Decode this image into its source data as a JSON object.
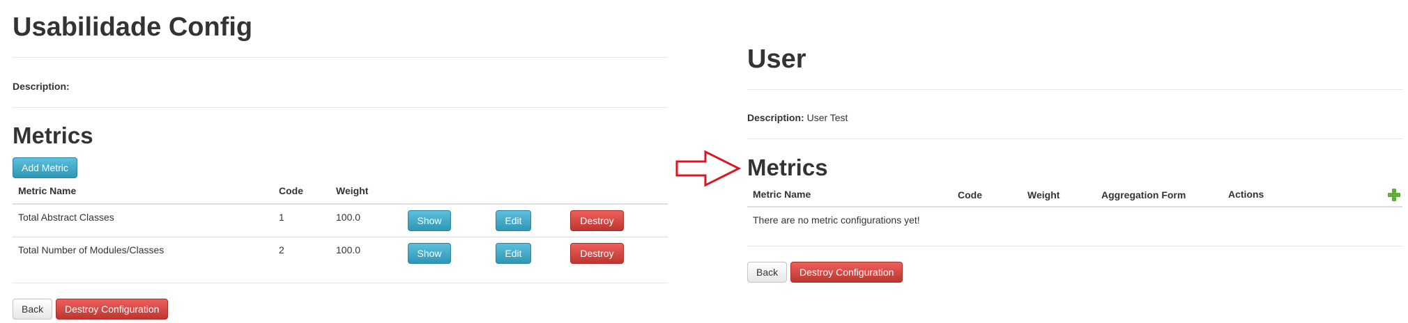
{
  "left": {
    "title": "Usabilidade Config",
    "description_label": "Description:",
    "description_value": "",
    "metrics_heading": "Metrics",
    "add_metric_label": "Add Metric",
    "table": {
      "headers": [
        "Metric Name",
        "Code",
        "Weight"
      ],
      "rows": [
        {
          "name": "Total Abstract Classes",
          "code": "1",
          "weight": "100.0"
        },
        {
          "name": "Total Number of Modules/Classes",
          "code": "2",
          "weight": "100.0"
        }
      ],
      "show_label": "Show",
      "edit_label": "Edit",
      "destroy_label": "Destroy"
    },
    "back_label": "Back",
    "destroy_config_label": "Destroy Configuration"
  },
  "right": {
    "title": "User",
    "description_label": "Description:",
    "description_value": "User Test",
    "metrics_heading": "Metrics",
    "table": {
      "headers": [
        "Metric Name",
        "Code",
        "Weight",
        "Aggregation Form",
        "Actions"
      ],
      "empty_message": "There are no metric configurations yet!"
    },
    "back_label": "Back",
    "destroy_config_label": "Destroy Configuration"
  },
  "colors": {
    "info": "#2f96b4",
    "danger": "#bd362f",
    "arrow": "#e0141e",
    "plus": "#5bb03c"
  },
  "icons": {
    "arrow": "right-arrow-outline-icon",
    "add": "plus-icon"
  }
}
